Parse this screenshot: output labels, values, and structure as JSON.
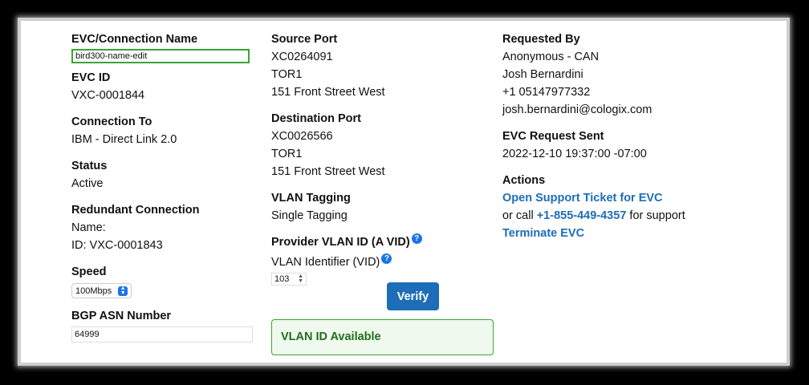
{
  "evc_name": {
    "label": "EVC/Connection Name",
    "value": "bird300-name-edit"
  },
  "evc_id": {
    "label": "EVC ID",
    "value": "VXC-0001844"
  },
  "connection_to": {
    "label": "Connection To",
    "value": "IBM - Direct Link 2.0"
  },
  "status": {
    "label": "Status",
    "value": "Active"
  },
  "redundant": {
    "label": "Redundant Connection",
    "name": "Name:",
    "id": "ID: VXC-0001843"
  },
  "speed": {
    "label": "Speed",
    "value": "100Mbps"
  },
  "bgp": {
    "label": "BGP ASN Number",
    "value": "64999"
  },
  "source_port": {
    "label": "Source Port",
    "code": "XC0264091",
    "site": "TOR1",
    "address": "151 Front Street West"
  },
  "destination_port": {
    "label": "Destination Port",
    "code": "XC0026566",
    "site": "TOR1",
    "address": "151 Front Street West"
  },
  "vlan_tagging": {
    "label": "VLAN Tagging",
    "value": "Single Tagging"
  },
  "provider_vlan": {
    "label": "Provider VLAN ID (A VID)",
    "identifier_label": "VLAN Identifier (VID)",
    "value": "103",
    "verify_label": "Verify",
    "status": "VLAN ID Available"
  },
  "requested_by": {
    "label": "Requested By",
    "org": "Anonymous - CAN",
    "name": "Josh Bernardini",
    "phone": "+1 05147977332",
    "email": "josh.bernardini@cologix.com"
  },
  "request_sent": {
    "label": "EVC Request Sent",
    "value": "2022-12-10 19:37:00 -07:00"
  },
  "actions": {
    "label": "Actions",
    "support_link": "Open Support Ticket for EVC",
    "call_prefix": "or call",
    "phone_link": "+1-855-449-4357",
    "call_suffix": "for support",
    "terminate_link": "Terminate EVC"
  },
  "colors": {
    "accent": "#1d6db8",
    "success": "#3aa536",
    "success_text": "#1f6e1a"
  }
}
